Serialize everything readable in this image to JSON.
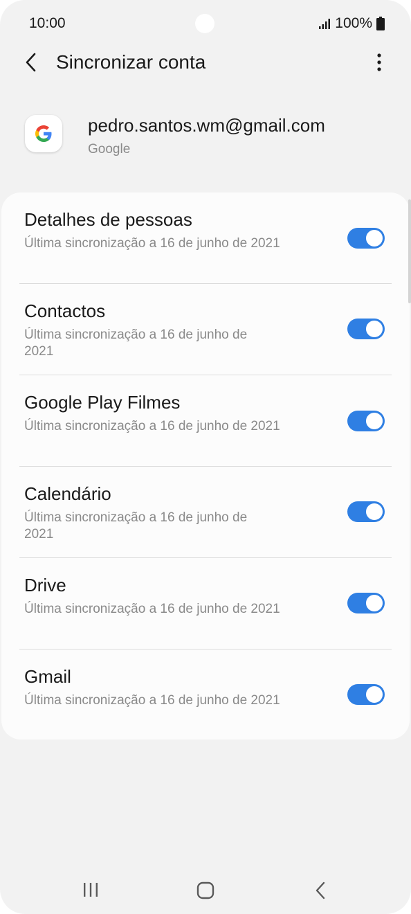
{
  "status_bar": {
    "time": "10:00",
    "battery": "100%",
    "icons": [
      "signal-icon",
      "battery-icon"
    ]
  },
  "header": {
    "title": "Sincronizar conta",
    "back_icon": "back-arrow-icon",
    "more_icon": "more-vert-icon"
  },
  "account": {
    "email": "pedro.santos.wm@gmail.com",
    "provider": "Google",
    "logo_icon": "google-logo-icon"
  },
  "sync_items": [
    {
      "title": "Detalhes de pessoas",
      "subtitle": "Última sincronização a 16 de junho de 2021",
      "enabled": true
    },
    {
      "title": "Contactos",
      "subtitle": "Última sincronização a 16 de junho de\n2021",
      "enabled": true
    },
    {
      "title": "Google Play Filmes",
      "subtitle": "Última sincronização a 16 de junho de 2021",
      "enabled": true
    },
    {
      "title": "Calendário",
      "subtitle": "Última sincronização a 16 de junho de\n2021",
      "enabled": true
    },
    {
      "title": "Drive",
      "subtitle": "Última sincronização a 16 de junho de 2021",
      "enabled": true
    },
    {
      "title": "Gmail",
      "subtitle": "Última sincronização a 16 de junho de 2021",
      "enabled": true
    }
  ],
  "nav_bar": {
    "icons": [
      "recents-icon",
      "home-icon",
      "back-icon"
    ]
  },
  "colors": {
    "accent": "#2f7fe3",
    "background": "#f2f2f2",
    "card": "#fcfcfc"
  }
}
